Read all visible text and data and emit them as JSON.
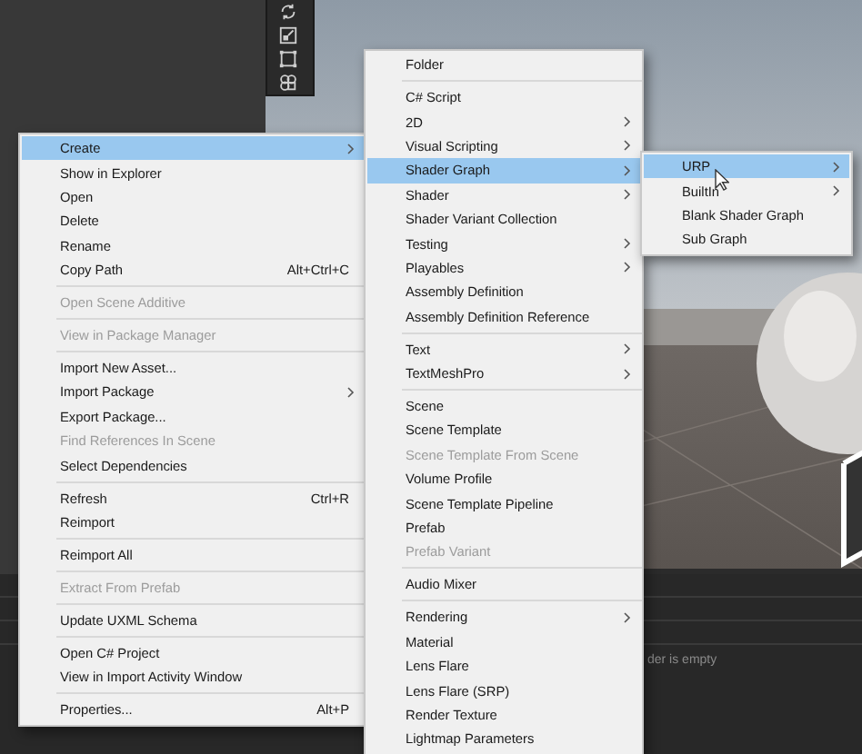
{
  "scene_toolbar": {
    "tools": [
      {
        "kind": "rotate"
      },
      {
        "kind": "scale"
      },
      {
        "kind": "rect"
      },
      {
        "kind": "transform"
      }
    ]
  },
  "console": {
    "message": "der is empty"
  },
  "context_menu": {
    "groups": [
      [
        {
          "label": "Create",
          "submenu": true,
          "disabled": false,
          "selected": true
        },
        {
          "label": "Show in Explorer",
          "submenu": false,
          "disabled": false,
          "selected": false
        },
        {
          "label": "Open",
          "submenu": false,
          "disabled": false,
          "selected": false
        },
        {
          "label": "Delete",
          "submenu": false,
          "disabled": false,
          "selected": false
        },
        {
          "label": "Rename",
          "submenu": false,
          "disabled": false,
          "selected": false
        },
        {
          "label": "Copy Path",
          "shortcut": "Alt+Ctrl+C",
          "submenu": false,
          "disabled": false,
          "selected": false
        }
      ],
      [
        {
          "label": "Open Scene Additive",
          "submenu": false,
          "disabled": true,
          "selected": false
        }
      ],
      [
        {
          "label": "View in Package Manager",
          "submenu": false,
          "disabled": true,
          "selected": false
        }
      ],
      [
        {
          "label": "Import New Asset...",
          "submenu": false,
          "disabled": false,
          "selected": false
        },
        {
          "label": "Import Package",
          "submenu": true,
          "disabled": false,
          "selected": false
        },
        {
          "label": "Export Package...",
          "submenu": false,
          "disabled": false,
          "selected": false
        },
        {
          "label": "Find References In Scene",
          "submenu": false,
          "disabled": true,
          "selected": false
        },
        {
          "label": "Select Dependencies",
          "submenu": false,
          "disabled": false,
          "selected": false
        }
      ],
      [
        {
          "label": "Refresh",
          "shortcut": "Ctrl+R",
          "submenu": false,
          "disabled": false,
          "selected": false
        },
        {
          "label": "Reimport",
          "submenu": false,
          "disabled": false,
          "selected": false
        }
      ],
      [
        {
          "label": "Reimport All",
          "submenu": false,
          "disabled": false,
          "selected": false
        }
      ],
      [
        {
          "label": "Extract From Prefab",
          "submenu": false,
          "disabled": true,
          "selected": false
        }
      ],
      [
        {
          "label": "Update UXML Schema",
          "submenu": false,
          "disabled": false,
          "selected": false
        }
      ],
      [
        {
          "label": "Open C# Project",
          "submenu": false,
          "disabled": false,
          "selected": false
        },
        {
          "label": "View in Import Activity Window",
          "submenu": false,
          "disabled": false,
          "selected": false
        }
      ],
      [
        {
          "label": "Properties...",
          "shortcut": "Alt+P",
          "submenu": false,
          "disabled": false,
          "selected": false
        }
      ]
    ]
  },
  "create_submenu": {
    "groups": [
      [
        {
          "label": "Folder",
          "submenu": false,
          "disabled": false,
          "selected": false
        }
      ],
      [
        {
          "label": "C# Script",
          "submenu": false,
          "disabled": false,
          "selected": false
        },
        {
          "label": "2D",
          "submenu": true,
          "disabled": false,
          "selected": false
        },
        {
          "label": "Visual Scripting",
          "submenu": true,
          "disabled": false,
          "selected": false
        },
        {
          "label": "Shader Graph",
          "submenu": true,
          "disabled": false,
          "selected": true
        },
        {
          "label": "Shader",
          "submenu": true,
          "disabled": false,
          "selected": false
        },
        {
          "label": "Shader Variant Collection",
          "submenu": false,
          "disabled": false,
          "selected": false
        },
        {
          "label": "Testing",
          "submenu": true,
          "disabled": false,
          "selected": false
        },
        {
          "label": "Playables",
          "submenu": true,
          "disabled": false,
          "selected": false
        },
        {
          "label": "Assembly Definition",
          "submenu": false,
          "disabled": false,
          "selected": false
        },
        {
          "label": "Assembly Definition Reference",
          "submenu": false,
          "disabled": false,
          "selected": false
        }
      ],
      [
        {
          "label": "Text",
          "submenu": true,
          "disabled": false,
          "selected": false
        },
        {
          "label": "TextMeshPro",
          "submenu": true,
          "disabled": false,
          "selected": false
        }
      ],
      [
        {
          "label": "Scene",
          "submenu": false,
          "disabled": false,
          "selected": false
        },
        {
          "label": "Scene Template",
          "submenu": false,
          "disabled": false,
          "selected": false
        },
        {
          "label": "Scene Template From Scene",
          "submenu": false,
          "disabled": true,
          "selected": false
        },
        {
          "label": "Volume Profile",
          "submenu": false,
          "disabled": false,
          "selected": false
        },
        {
          "label": "Scene Template Pipeline",
          "submenu": false,
          "disabled": false,
          "selected": false
        },
        {
          "label": "Prefab",
          "submenu": false,
          "disabled": false,
          "selected": false
        },
        {
          "label": "Prefab Variant",
          "submenu": false,
          "disabled": true,
          "selected": false
        }
      ],
      [
        {
          "label": "Audio Mixer",
          "submenu": false,
          "disabled": false,
          "selected": false
        }
      ],
      [
        {
          "label": "Rendering",
          "submenu": true,
          "disabled": false,
          "selected": false
        },
        {
          "label": "Material",
          "submenu": false,
          "disabled": false,
          "selected": false
        },
        {
          "label": "Lens Flare",
          "submenu": false,
          "disabled": false,
          "selected": false
        },
        {
          "label": "Lens Flare (SRP)",
          "submenu": false,
          "disabled": false,
          "selected": false
        },
        {
          "label": "Render Texture",
          "submenu": false,
          "disabled": false,
          "selected": false
        },
        {
          "label": "Lightmap Parameters",
          "submenu": false,
          "disabled": false,
          "selected": false
        }
      ]
    ]
  },
  "shader_graph_submenu": {
    "groups": [
      [
        {
          "label": "URP",
          "submenu": true,
          "disabled": false,
          "selected": true
        },
        {
          "label": "BuiltIn",
          "submenu": true,
          "disabled": false,
          "selected": false
        },
        {
          "label": "Blank Shader Graph",
          "submenu": false,
          "disabled": false,
          "selected": false
        },
        {
          "label": "Sub Graph",
          "submenu": false,
          "disabled": false,
          "selected": false
        }
      ]
    ]
  }
}
